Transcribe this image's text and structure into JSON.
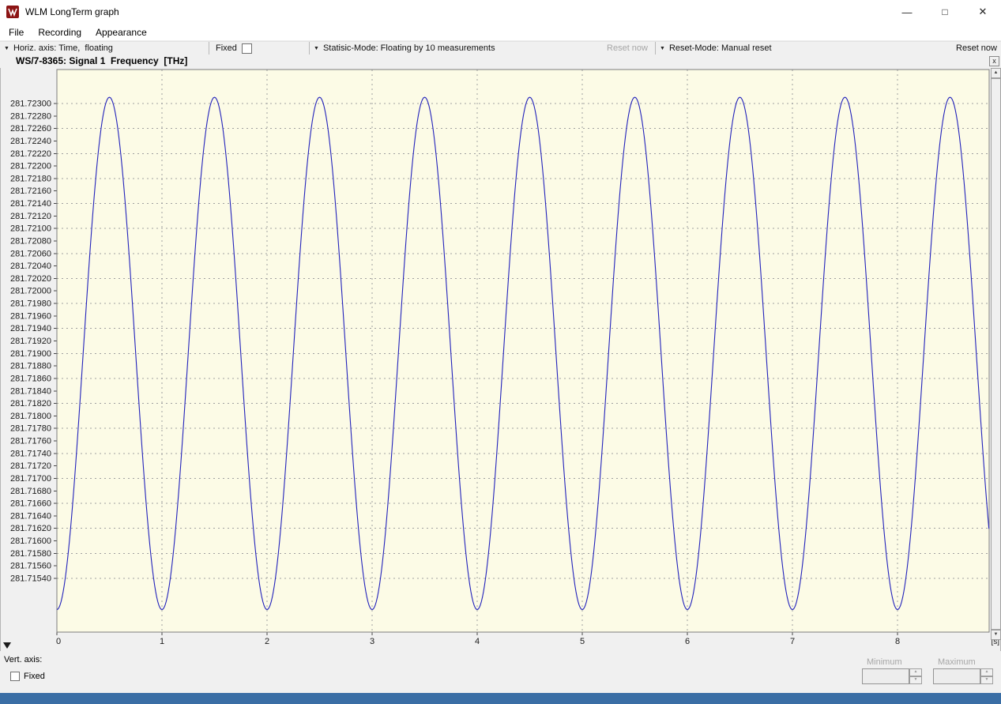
{
  "window": {
    "title": "WLM LongTerm graph",
    "controls": {
      "minimize": "—",
      "maximize": "□",
      "close": "✕"
    }
  },
  "menu": {
    "items": [
      "File",
      "Recording",
      "Appearance"
    ]
  },
  "toolbar": {
    "horiz_axis_label": "Horiz. axis: Time,  floating",
    "fixed_label": "Fixed",
    "fixed_checked": false,
    "statistic_mode_label": "Statisic-Mode: Floating by 10 measurements",
    "statistic_reset_label": "Reset now",
    "statistic_reset_enabled": false,
    "reset_mode_label": "Reset-Mode: Manual reset",
    "reset_now_label": "Reset now",
    "reset_now_enabled": true
  },
  "chart": {
    "heading": "WS/7-8365: Signal 1  Frequency  [THz]"
  },
  "bottom_panel": {
    "vert_axis_label": "Vert. axis:",
    "fixed_label": "Fixed",
    "fixed_checked": false,
    "minimum_label": "Minimum",
    "minimum_value": "",
    "maximum_label": "Maximum",
    "maximum_value": ""
  },
  "icons": {
    "dropdown_arrow": "▼",
    "pane_close": "x",
    "scroll_up": "▲",
    "scroll_down": "▼",
    "spin_up": "▲",
    "spin_down": "▼"
  },
  "colors": {
    "plot_bg": "#fcfbe6",
    "grid": "#a0a0a0",
    "curve": "#2222bb",
    "axis_text": "#1a1a1a",
    "panel_bg": "#f0f0f0",
    "titlebar_bg": "#ffffff",
    "status_strip": "#3a6ea5",
    "logo_red": "#8c1414",
    "disabled_text": "#a6a6a6"
  },
  "chart_data": {
    "type": "line",
    "title": "WS/7-8365: Signal 1  Frequency  [THz]",
    "x_unit_label": "[s]",
    "x_ticks": [
      0,
      1,
      2,
      3,
      4,
      5,
      6,
      7,
      8
    ],
    "y_ticks": [
      "281.72300",
      "281.72280",
      "281.72260",
      "281.72240",
      "281.72220",
      "281.72200",
      "281.72180",
      "281.72160",
      "281.72140",
      "281.72120",
      "281.72100",
      "281.72080",
      "281.72060",
      "281.72040",
      "281.72020",
      "281.72000",
      "281.71980",
      "281.71960",
      "281.71940",
      "281.71920",
      "281.71900",
      "281.71880",
      "281.71860",
      "281.71840",
      "281.71820",
      "281.71800",
      "281.71780",
      "281.71760",
      "281.71740",
      "281.71720",
      "281.71700",
      "281.71680",
      "281.71660",
      "281.71640",
      "281.71620",
      "281.71600",
      "281.71580",
      "281.71560",
      "281.71540"
    ],
    "y_tick_step_thz": 0.0002,
    "xlim": [
      0,
      8.87
    ],
    "ylim": [
      281.71455,
      281.72355
    ],
    "grid": {
      "dashed": true,
      "h_line_every_n_ticks": 2,
      "v_lines_at_x_ticks": true
    },
    "series": [
      {
        "name": "Signal 1 Frequency",
        "color": "#2222bb",
        "waveform": {
          "shape": "sine",
          "center_thz": 281.719,
          "amplitude_thz": 0.0041,
          "period_s": 1.0,
          "trough_at_s": 0.0,
          "t_start_s": 0.0,
          "t_end_s": 8.87,
          "sample_step_s": 0.01
        }
      }
    ]
  }
}
